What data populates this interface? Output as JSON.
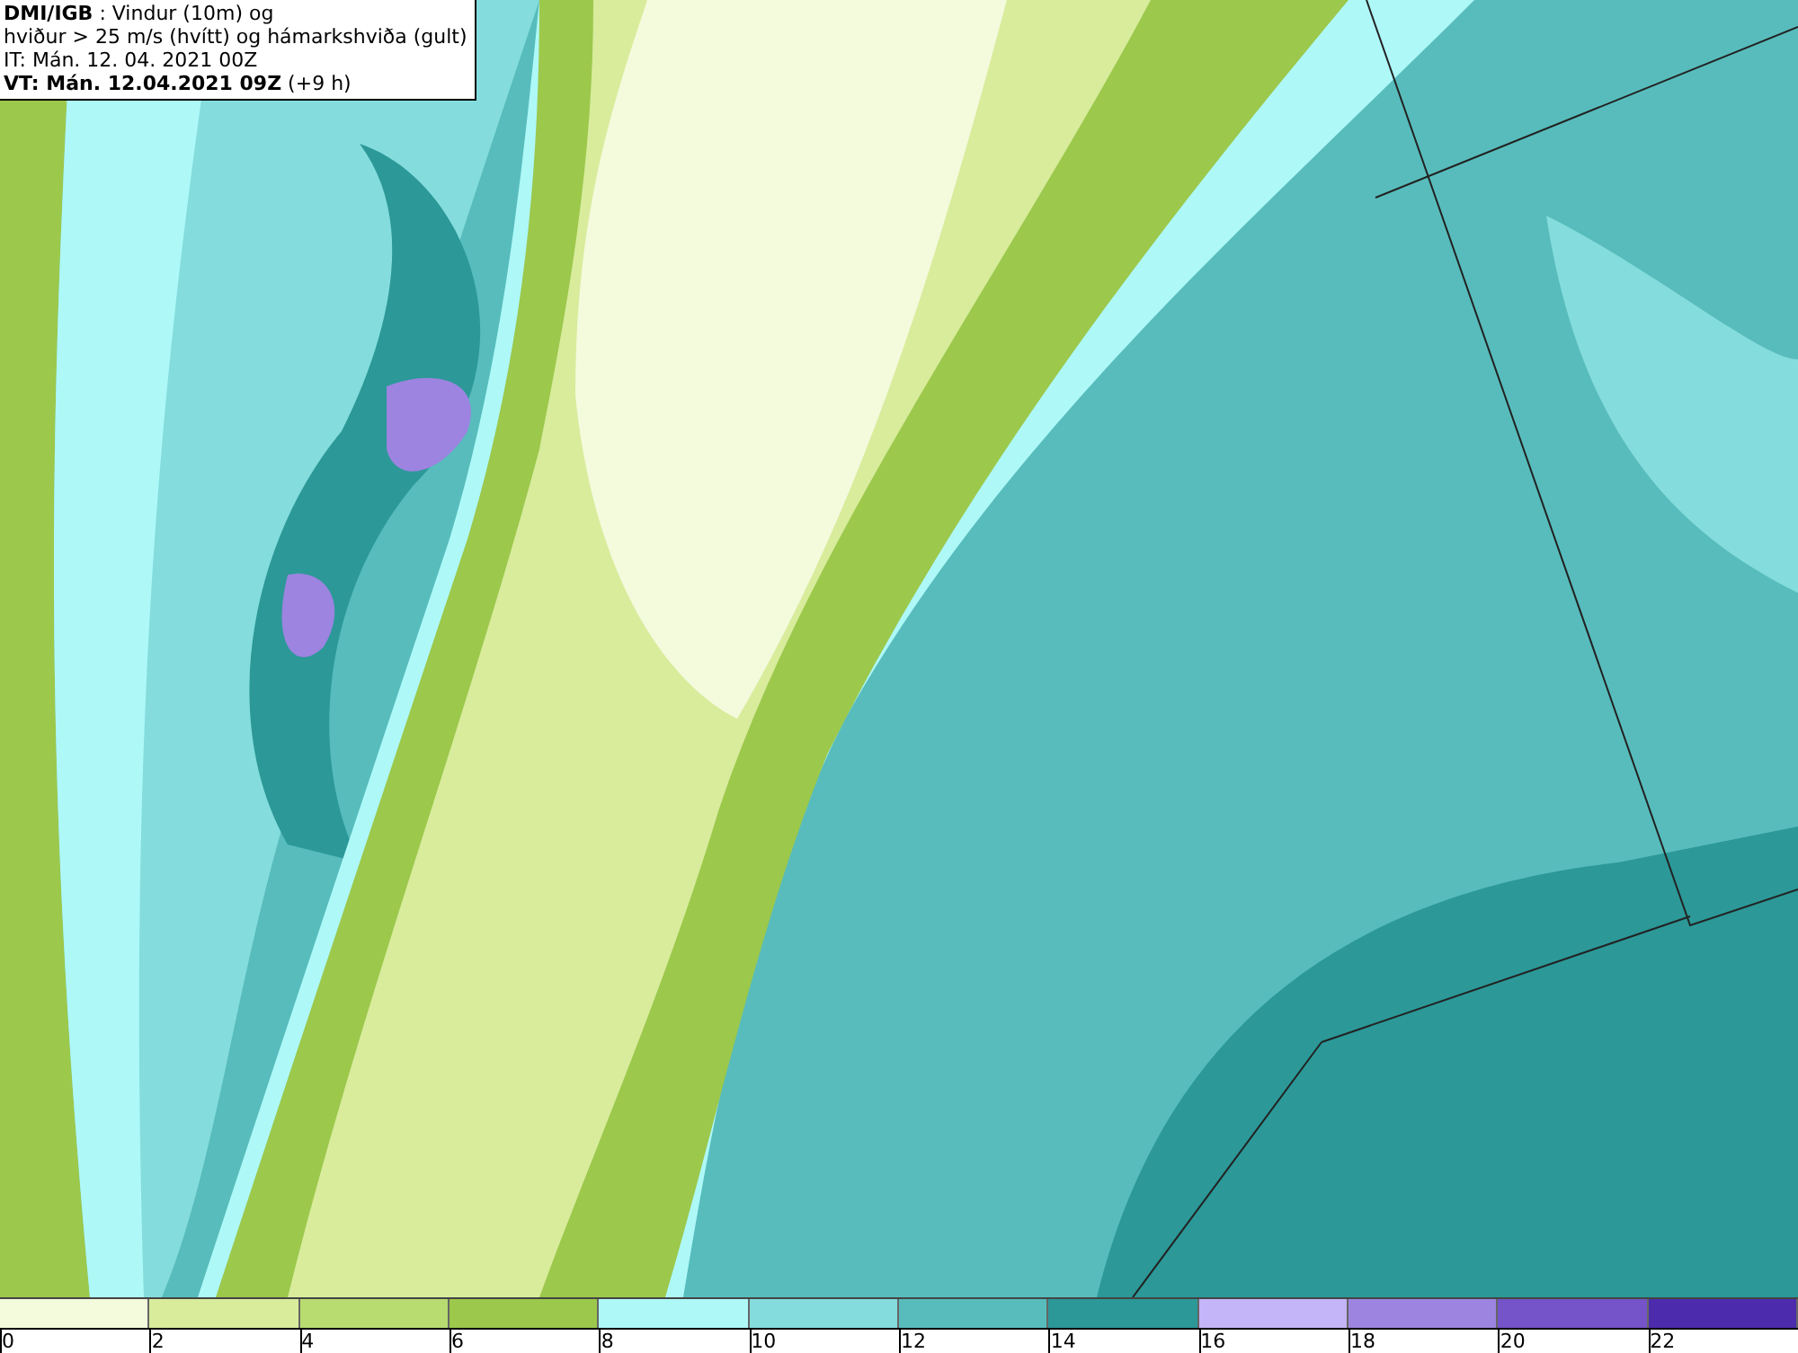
{
  "header": {
    "lines": [
      "**DMI/IGB** : Vindur (10m) og",
      "hviður > 25 m/s (hvítt) og hámarkshviða (gult)",
      "IT: Mán. 12. 04. 2021 00Z",
      "**VT: Mán. 12.04.2021 09Z** (+9 h)"
    ]
  },
  "legend": {
    "bins": [
      {
        "color": "#f4fadc"
      },
      {
        "color": "#d8ec9c"
      },
      {
        "color": "#b8dc70"
      },
      {
        "color": "#9cc84c"
      },
      {
        "color": "#aef8f8"
      },
      {
        "color": "#84dcdc"
      },
      {
        "color": "#58bcbc"
      },
      {
        "color": "#2c9898"
      },
      {
        "color": "#c4b4f8"
      },
      {
        "color": "#9c84e0"
      },
      {
        "color": "#7454c8"
      },
      {
        "color": "#4c2cac"
      }
    ],
    "ticks": [
      "0",
      "2",
      "4",
      "6",
      "8",
      "10",
      "12",
      "14",
      "16",
      "18",
      "20",
      "22"
    ]
  }
}
